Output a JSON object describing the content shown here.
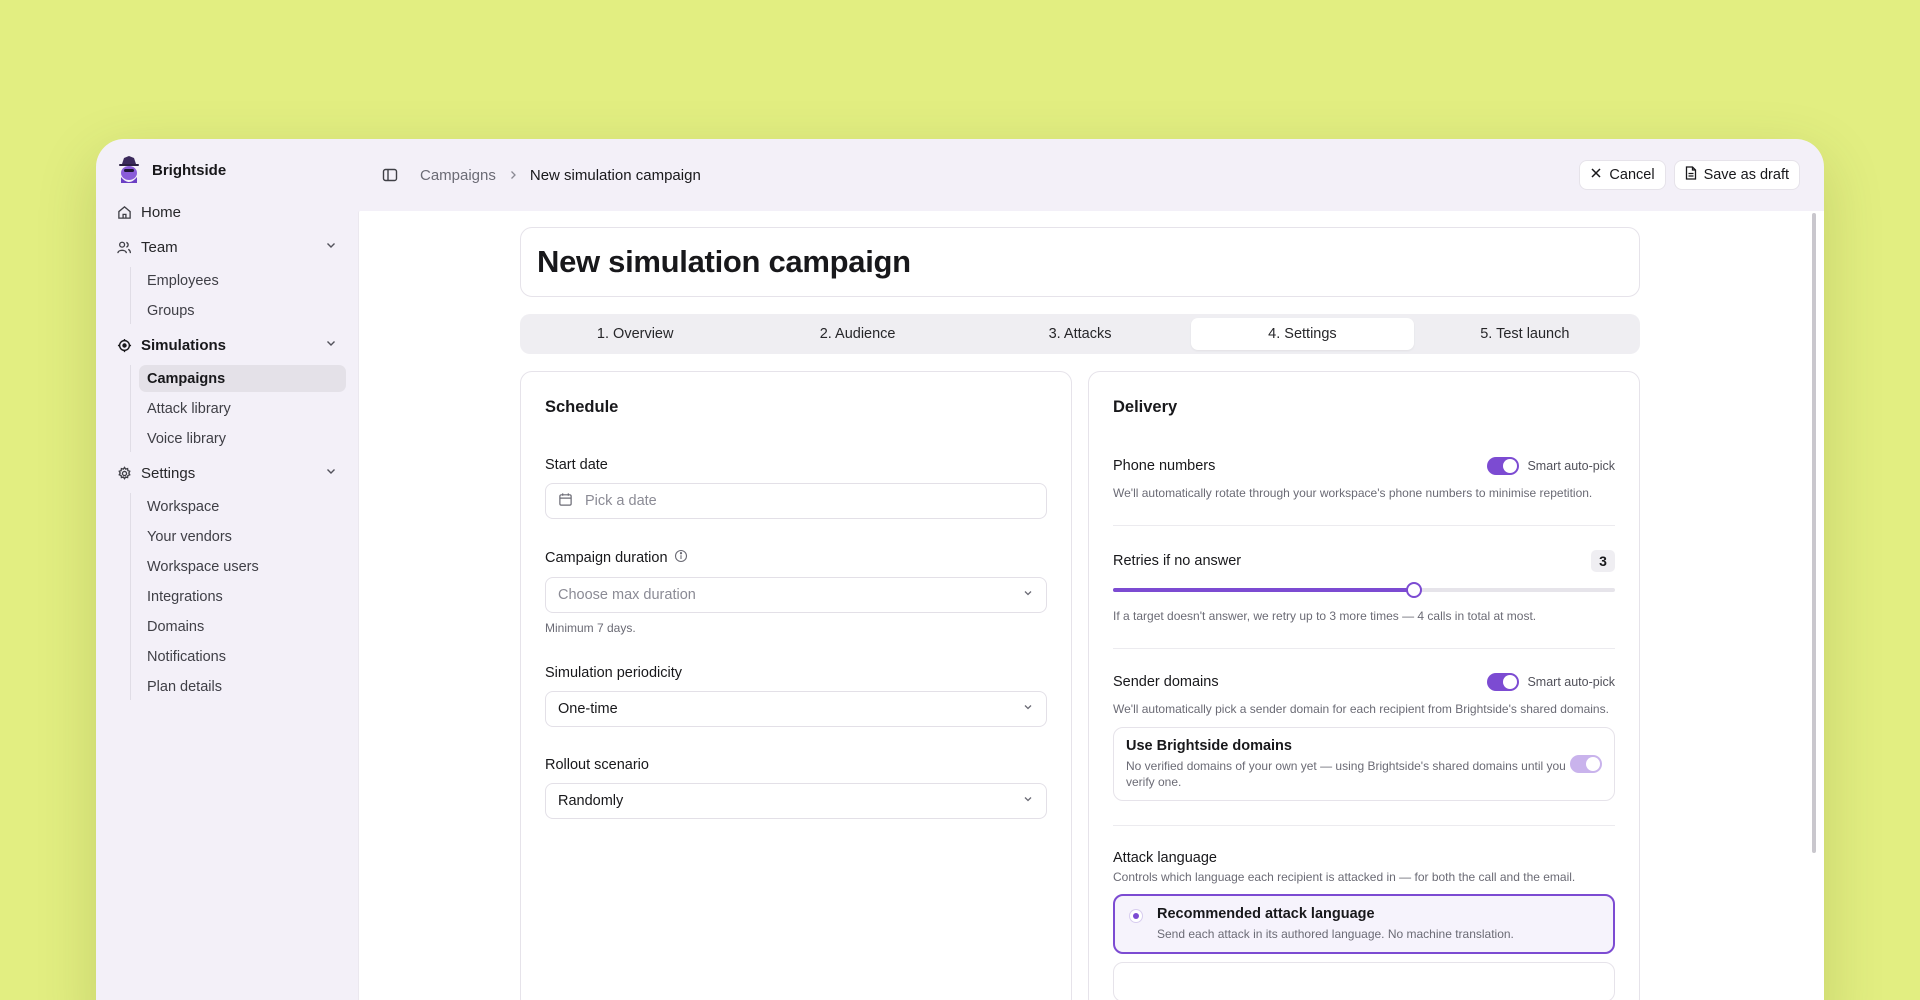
{
  "brand": {
    "name": "Brightside"
  },
  "sidebar": {
    "home": "Home",
    "team": {
      "label": "Team",
      "items": [
        "Employees",
        "Groups"
      ]
    },
    "simulations": {
      "label": "Simulations",
      "items": [
        "Campaigns",
        "Attack library",
        "Voice library"
      ]
    },
    "settings": {
      "label": "Settings",
      "items": [
        "Workspace",
        "Your vendors",
        "Workspace users",
        "Integrations",
        "Domains",
        "Notifications",
        "Plan details"
      ]
    }
  },
  "topbar": {
    "breadcrumb_parent": "Campaigns",
    "breadcrumb_current": "New simulation campaign",
    "cancel_label": "Cancel",
    "save_draft_label": "Save as draft"
  },
  "page": {
    "title": "New simulation campaign",
    "steps": [
      "1. Overview",
      "2. Audience",
      "3. Attacks",
      "4. Settings",
      "5. Test launch"
    ],
    "active_step": 3
  },
  "schedule": {
    "title": "Schedule",
    "start_date": {
      "label": "Start date",
      "placeholder": "Pick a date"
    },
    "duration": {
      "label": "Campaign duration",
      "placeholder": "Choose max duration",
      "help": "Minimum 7 days."
    },
    "periodicity": {
      "label": "Simulation periodicity",
      "value": "One-time"
    },
    "rollout": {
      "label": "Rollout scenario",
      "value": "Randomly"
    }
  },
  "delivery": {
    "title": "Delivery",
    "phone_numbers": {
      "label": "Phone numbers",
      "toggle_label": "Smart auto-pick",
      "toggle_on": true,
      "help": "We'll automatically rotate through your workspace's phone numbers to minimise repetition."
    },
    "retries": {
      "label": "Retries if no answer",
      "value": "3",
      "slider_fraction": 0.6,
      "help": "If a target doesn't answer, we retry up to 3 more times — 4 calls in total at most."
    },
    "sender_domains": {
      "label": "Sender domains",
      "toggle_label": "Smart auto-pick",
      "toggle_on": true,
      "help": "We'll automatically pick a sender domain for each recipient from Brightside's shared domains.",
      "brightside_domains": {
        "title": "Use Brightside domains",
        "desc": "No verified domains of your own yet — using Brightside's shared domains until you verify one.",
        "toggle_on": true
      }
    },
    "attack_language": {
      "label": "Attack language",
      "desc": "Controls which language each recipient is attacked in — for both the call and the email.",
      "options": [
        {
          "title": "Recommended attack language",
          "desc": "Send each attack in its authored language. No machine translation.",
          "selected": true
        }
      ]
    }
  },
  "colors": {
    "accent": "#7c4bd2",
    "background": "#e2ee81",
    "window": "#f3f0f8"
  }
}
